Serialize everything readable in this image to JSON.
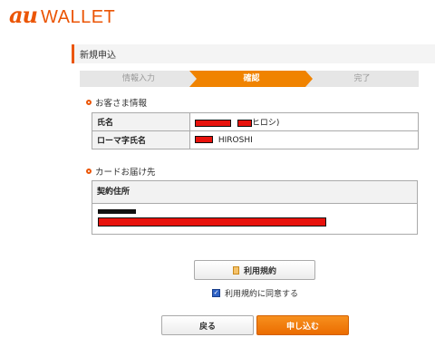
{
  "logo": {
    "au": "au",
    "wallet": "WALLET"
  },
  "page": {
    "title": "新規申込"
  },
  "steps": [
    {
      "label": "情報入力",
      "state": "done"
    },
    {
      "label": "確認",
      "state": "current"
    },
    {
      "label": "完了",
      "state": "pending"
    }
  ],
  "customer": {
    "heading": "お客さま情報",
    "name_label": "氏名",
    "name_kana_suffix": "ヒロシ)",
    "roman_label": "ローマ字氏名",
    "roman_value": "HIROSHI"
  },
  "delivery": {
    "heading": "カードお届け先",
    "address_label": "契約住所"
  },
  "terms": {
    "button_label": "利用規約",
    "agree_label": "利用規約に同意する",
    "agree_checked": true
  },
  "actions": {
    "back_label": "戻る",
    "submit_label": "申し込む"
  },
  "colors": {
    "brand": "#eb5505",
    "step_active": "#f08300",
    "redaction": "#e8120c"
  }
}
